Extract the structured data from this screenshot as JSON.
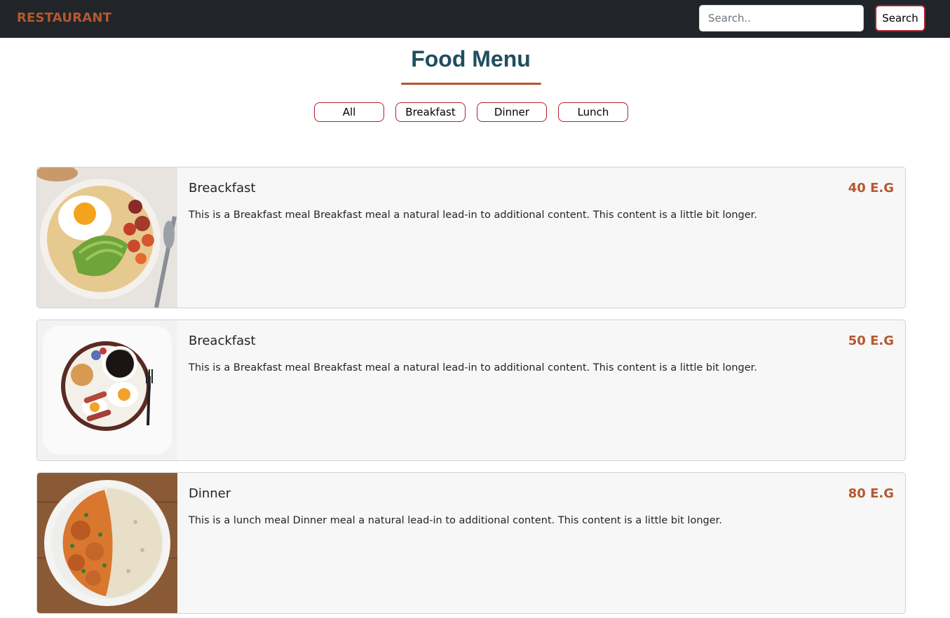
{
  "navbar": {
    "brand": "RESTAURANT",
    "search_placeholder": "Search..",
    "search_button": "Search"
  },
  "page": {
    "title": "Food Menu"
  },
  "filters": [
    "All",
    "Breakfast",
    "Dinner",
    "Lunch"
  ],
  "menu_items": [
    {
      "title": "Breackfast",
      "price": "40 E.G",
      "description": "This is a Breakfast meal Breakfast meal a natural lead-in to additional content. This content is a little bit longer.",
      "image": "breakfast-bowl-egg-avocado-photo"
    },
    {
      "title": "Breackfast",
      "price": "50 E.G",
      "description": "This is a Breakfast meal Breakfast meal a natural lead-in to additional content. This content is a little bit longer.",
      "image": "breakfast-plate-coffee-eggs-photo"
    },
    {
      "title": "Dinner",
      "price": "80 E.G",
      "description": "This is a lunch meal Dinner meal a natural lead-in to additional content. This content is a little bit longer.",
      "image": "curry-rice-plate-photo"
    }
  ],
  "colors": {
    "navbar_bg": "#212529",
    "accent": "#b5582f",
    "title": "#1f4e5f",
    "button_border": "#b0202f",
    "card_bg": "#f7f7f7"
  }
}
